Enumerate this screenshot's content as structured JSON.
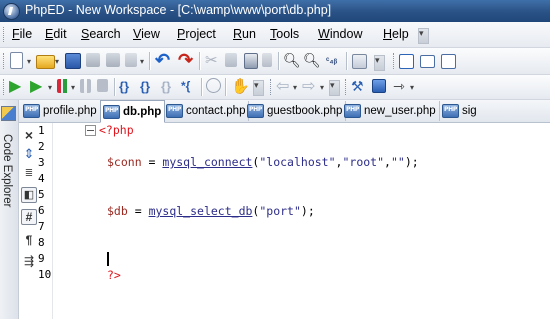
{
  "window": {
    "title": "PhpED - New Workspace - [C:\\wamp\\www\\port\\db.php]"
  },
  "menu": [
    {
      "label": "File",
      "u": "F",
      "rest": "ile"
    },
    {
      "label": "Edit",
      "u": "E",
      "rest": "dit"
    },
    {
      "label": "Search",
      "u": "S",
      "rest": "earch"
    },
    {
      "label": "View",
      "u": "V",
      "rest": "iew"
    },
    {
      "label": "Project",
      "u": "P",
      "rest": "roject"
    },
    {
      "label": "Run",
      "u": "R",
      "rest": "un"
    },
    {
      "label": "Tools",
      "u": "T",
      "rest": "ools"
    },
    {
      "label": "Window",
      "u": "W",
      "rest": "indow"
    },
    {
      "label": "Help",
      "u": "H",
      "rest": "elp"
    }
  ],
  "sidebar": {
    "label": "Code Explorer"
  },
  "tabs": [
    {
      "label": "profile.php",
      "active": false
    },
    {
      "label": "db.php",
      "active": true
    },
    {
      "label": "contact.php",
      "active": false
    },
    {
      "label": "guestbook.php",
      "active": false
    },
    {
      "label": "new_user.php",
      "active": false
    },
    {
      "label": "sig",
      "active": false
    }
  ],
  "gutter_icons": [
    "close-icon",
    "scroll-sync-icon",
    "wrap-icon",
    "split-icon",
    "hash-icon",
    "pilcrow-icon",
    "indent-icon"
  ],
  "editor": {
    "line_numbers": [
      "1",
      "2",
      "3",
      "4",
      "5",
      "6",
      "7",
      "8",
      "9",
      "10"
    ],
    "lines": {
      "open_tag": "<?php",
      "l3_var": "$conn",
      "l3_eq": " = ",
      "l3_fn": "mysql_connect",
      "l3_args_open": "(",
      "l3_a1": "\"localhost\"",
      "l3_c1": ",",
      "l3_a2": "\"root\"",
      "l3_c2": ",",
      "l3_a3": "\"\"",
      "l3_end": ");",
      "l6_var": "$db",
      "l6_eq": " = ",
      "l6_fn": "mysql_select_db",
      "l6_open": "(",
      "l6_a1": "\"port\"",
      "l6_end": ");",
      "close_tag": "?>"
    }
  },
  "colors": {
    "keyword": "#e0141c",
    "variable": "#9a2a22",
    "function": "#2d2d8a",
    "string": "#2d2d8a",
    "titlebar": "#2a5286"
  }
}
